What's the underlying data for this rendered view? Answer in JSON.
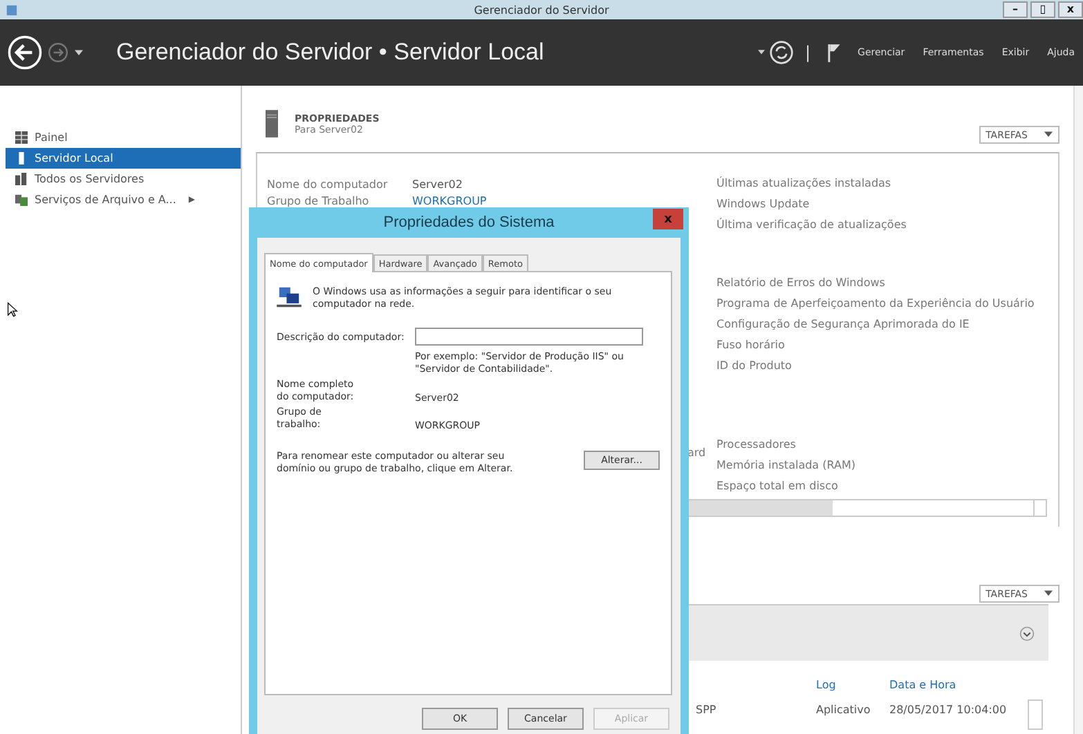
{
  "window": {
    "title": "Gerenciador do Servidor",
    "controls": [
      "–",
      "▯",
      "x"
    ]
  },
  "header": {
    "title": "Gerenciador do Servidor • Servidor Local",
    "menus": [
      "Gerenciar",
      "Ferramentas",
      "Exibir",
      "Ajuda"
    ],
    "separator": "|"
  },
  "sidebar": {
    "items": [
      {
        "label": "Painel",
        "kind": "grid",
        "selected": false
      },
      {
        "label": "Servidor Local",
        "kind": "server",
        "selected": true
      },
      {
        "label": "Todos os Servidores",
        "kind": "servers",
        "selected": false
      },
      {
        "label": "Serviços de Arquivo e A...",
        "kind": "files",
        "selected": false,
        "expander": "▶"
      }
    ]
  },
  "properties": {
    "title": "PROPRIEDADES",
    "subtitle": "Para Server02",
    "tasks": "TAREFAS",
    "left_rows": [
      {
        "label": "Nome do computador",
        "value": "Server02",
        "link": false
      },
      {
        "label": "Grupo de Trabalho",
        "value": "WORKGROUP",
        "link": true
      }
    ],
    "left_partial": "ard",
    "right_groups": [
      [
        "Últimas atualizações instaladas",
        "Windows Update",
        "Última verificação de atualizações"
      ],
      [
        "Relatório de Erros do Windows",
        "Programa de Aperfeiçoamento da Experiência do Usuário",
        "Configuração de Segurança Aprimorada do IE",
        "Fuso horário",
        "ID do Produto"
      ],
      [
        "Processadores",
        "Memória instalada (RAM)",
        "Espaço total em disco"
      ]
    ]
  },
  "events": {
    "tasks": "TAREFAS",
    "columns": [
      "Log",
      "Data e Hora"
    ],
    "rows": [
      {
        "partial": "SPP",
        "log": "Aplicativo",
        "date": "28/05/2017 10:04:00"
      }
    ]
  },
  "dialog": {
    "title": "Propriedades do Sistema",
    "close": "x",
    "tabs": [
      {
        "label": "Nome do computador",
        "selected": true
      },
      {
        "label": "Hardware",
        "selected": false
      },
      {
        "label": "Avançado",
        "selected": false
      },
      {
        "label": "Remoto",
        "selected": false
      }
    ],
    "intro": "O Windows usa as informações a seguir para identificar o seu computador na rede.",
    "description_label": "Descrição do computador:",
    "hint": "Por exemplo: \"Servidor de Produção IIS\" ou \"Servidor de Contabilidade\".",
    "rows": [
      {
        "label": "Nome completo do computador:",
        "value": "Server02"
      },
      {
        "label": "Grupo de trabalho:",
        "value": "WORKGROUP"
      }
    ],
    "rename_text": "Para renomear este computador ou alterar seu domínio ou grupo de trabalho, clique em Alterar.",
    "change_button": "Alterar...",
    "buttons": [
      {
        "label": "OK",
        "disabled": false
      },
      {
        "label": "Cancelar",
        "disabled": false
      },
      {
        "label": "Aplicar",
        "disabled": true
      }
    ]
  }
}
